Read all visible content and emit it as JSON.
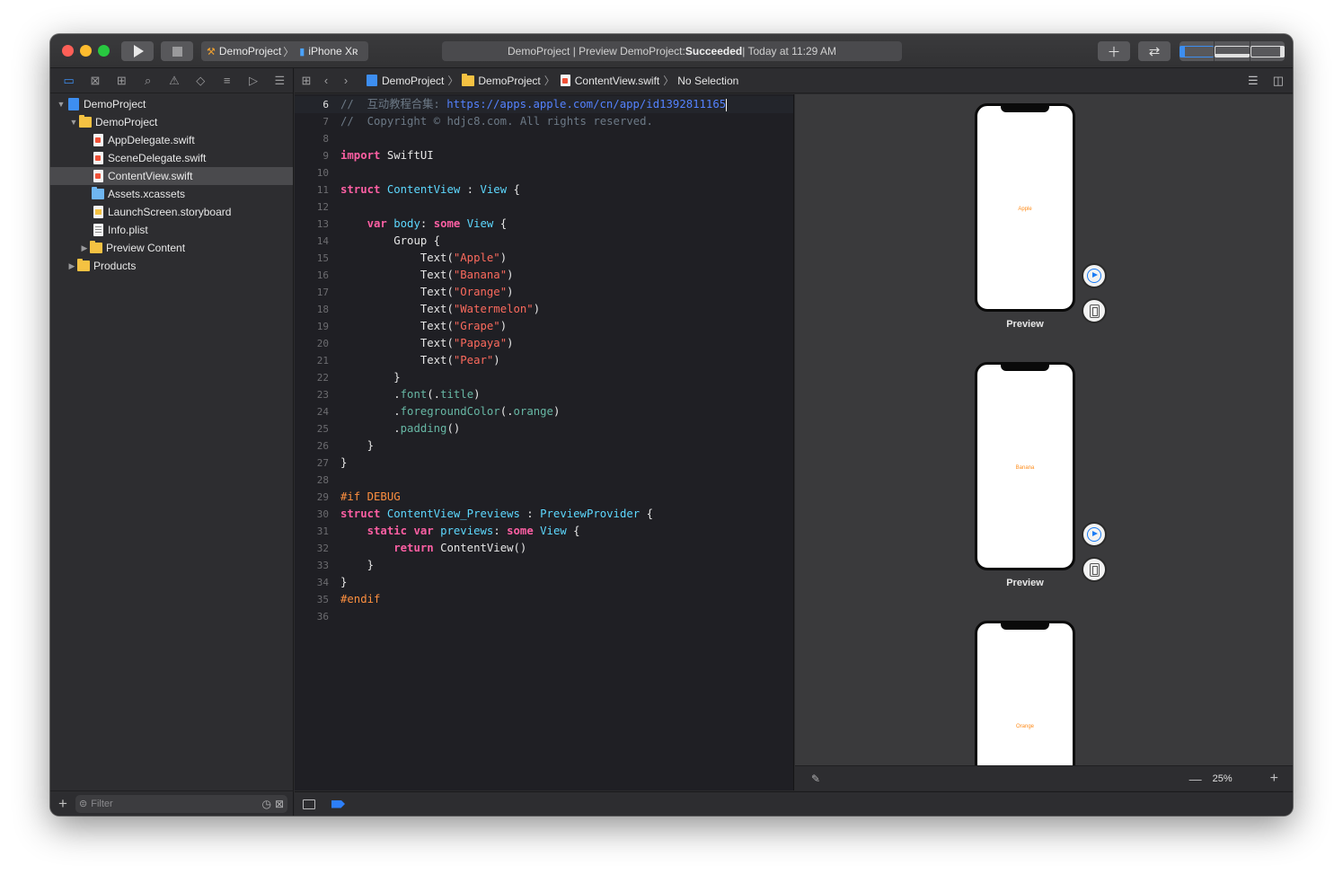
{
  "titlebar": {
    "scheme_project": "DemoProject",
    "scheme_device": "iPhone Xʀ",
    "activity_prefix": "DemoProject | Preview DemoProject: ",
    "activity_status": "Succeeded",
    "activity_time": " | Today at 11:29 AM"
  },
  "navigator": {
    "items": [
      {
        "label": "DemoProject"
      },
      {
        "label": "DemoProject"
      },
      {
        "label": "AppDelegate.swift"
      },
      {
        "label": "SceneDelegate.swift"
      },
      {
        "label": "ContentView.swift"
      },
      {
        "label": "Assets.xcassets"
      },
      {
        "label": "LaunchScreen.storyboard"
      },
      {
        "label": "Info.plist"
      },
      {
        "label": "Preview Content"
      },
      {
        "label": "Products"
      }
    ],
    "filter_placeholder": "Filter"
  },
  "jumpbar": {
    "crumbs": [
      "DemoProject",
      "DemoProject",
      "ContentView.swift",
      "No Selection"
    ]
  },
  "editor": {
    "line_numbers": [
      "6",
      "7",
      "8",
      "9",
      "10",
      "11",
      "12",
      "13",
      "14",
      "15",
      "16",
      "17",
      "18",
      "19",
      "20",
      "21",
      "22",
      "23",
      "24",
      "25",
      "26",
      "27",
      "28",
      "29",
      "30",
      "31",
      "32",
      "33",
      "34",
      "35",
      "36"
    ],
    "tokens": {
      "l6_comment": "//  互动教程合集: ",
      "l6_url": "https://apps.apple.com/cn/app/id1392811165",
      "l7_comment": "//  Copyright © hdjc8.com. All rights reserved.",
      "import_kw": "import",
      "import_mod": " SwiftUI",
      "struct_kw": "struct",
      "content_view": "ContentView",
      "colon": " : ",
      "view_type": "View",
      "open_brace": " {",
      "var_kw": "var",
      "body_name": "body",
      "some_kw": "some",
      "group": "Group",
      "text_fn": "Text",
      "fruits": [
        "\"Apple\"",
        "\"Banana\"",
        "\"Orange\"",
        "\"Watermelon\"",
        "\"Grape\"",
        "\"Papaya\"",
        "\"Pear\""
      ],
      "close_brace": "}",
      "font_mod": "font",
      "title_arg": "title",
      "fg_mod": "foregroundColor",
      "orange_arg": "orange",
      "padding_mod": "padding",
      "if_debug": "#if DEBUG",
      "previews_struct": "ContentView_Previews",
      "preview_provider": "PreviewProvider",
      "static_kw": "static",
      "previews_name": "previews",
      "return_kw": "return",
      "content_view_call": "ContentView()",
      "endif": "#endif"
    }
  },
  "preview": {
    "devices": [
      {
        "text": "Apple",
        "label": "Preview"
      },
      {
        "text": "Banana",
        "label": "Preview"
      },
      {
        "text": "Orange",
        "label": ""
      }
    ],
    "zoom": "25%"
  },
  "colors": {
    "accent": "#3d8ef0",
    "keyword": "#fc5fa3",
    "type": "#5dd8ff",
    "string": "#fc6a5d",
    "comment": "#6c7986",
    "preprocessor": "#fd8f3f",
    "preview_text": "#ff8c1a"
  },
  "icons": [
    "play-icon",
    "stop-icon",
    "plus-icon",
    "swap-icon",
    "left-panel-icon",
    "bottom-panel-icon",
    "right-panel-icon",
    "folder-icon",
    "swift-file-icon",
    "pin-icon"
  ]
}
